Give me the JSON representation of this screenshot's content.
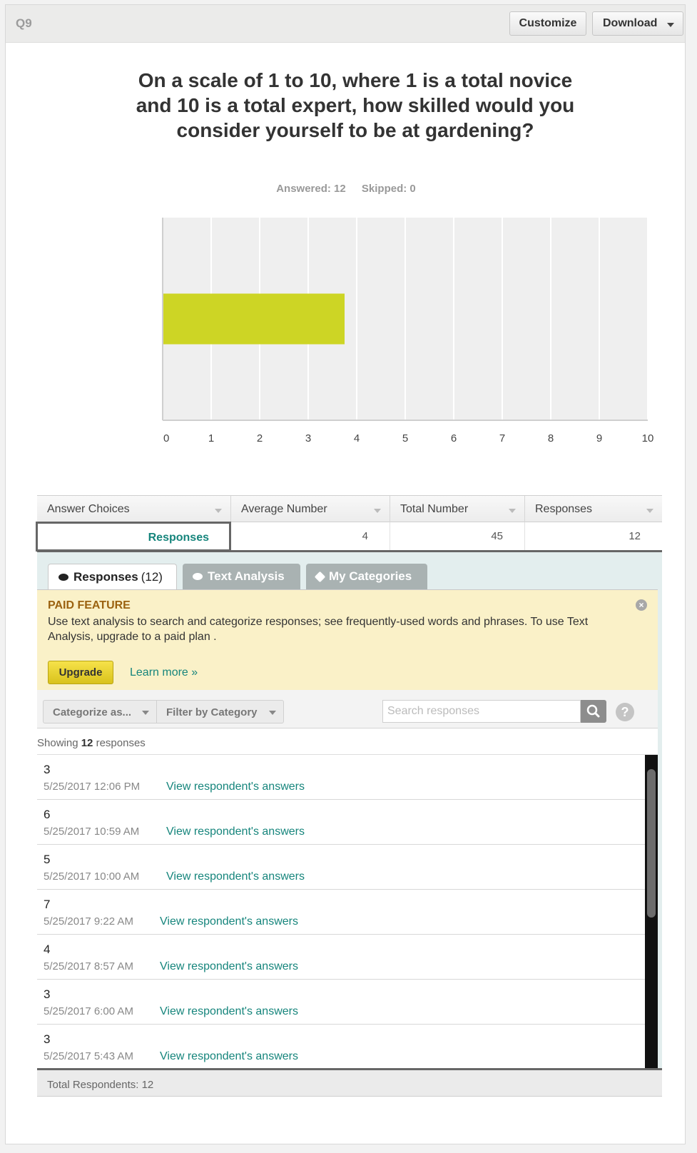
{
  "header": {
    "question_id": "Q9",
    "customize_label": "Customize",
    "download_label": "Download"
  },
  "question": {
    "title": "On a scale of 1 to 10, where 1 is a total novice and 10 is a total expert, how skilled would you consider yourself to be at gardening?",
    "answered": "Answered: 12",
    "skipped": "Skipped: 0"
  },
  "chart_data": {
    "type": "bar",
    "orientation": "horizontal",
    "categories": [
      "Responses"
    ],
    "values": [
      3.75
    ],
    "xlim": [
      0,
      10
    ],
    "x_ticks": [
      "0",
      "1",
      "2",
      "3",
      "4",
      "5",
      "6",
      "7",
      "8",
      "9",
      "10"
    ],
    "bar_color": "#cdd525",
    "grid": true,
    "title": "",
    "xlabel": "",
    "ylabel": ""
  },
  "table": {
    "headers": [
      "Answer Choices",
      "Average Number",
      "Total Number",
      "Responses"
    ],
    "row": {
      "choice": "Responses",
      "average": "4",
      "total": "45",
      "responses": "12"
    }
  },
  "tabs": {
    "responses_label": "Responses",
    "responses_count": "(12)",
    "text_analysis_label": "Text Analysis",
    "my_categories_label": "My Categories"
  },
  "paid_feature": {
    "title": "PAID FEATURE",
    "text": "Use text analysis to search and categorize responses; see frequently-used words and phrases. To use Text Analysis, upgrade to a paid plan .",
    "close_glyph": "×",
    "upgrade_label": "Upgrade",
    "learn_more_label": "Learn more »"
  },
  "filters": {
    "categorize_label": "Categorize as...",
    "filter_label": "Filter by Category",
    "search_placeholder": "Search responses",
    "help_glyph": "?"
  },
  "showing": {
    "prefix": "Showing",
    "count": "12",
    "suffix": "responses"
  },
  "responses": [
    {
      "value": "3",
      "date": "5/25/2017 12:06 PM",
      "link": "View respondent's answers"
    },
    {
      "value": "6",
      "date": "5/25/2017 10:59 AM",
      "link": "View respondent's answers"
    },
    {
      "value": "5",
      "date": "5/25/2017 10:00 AM",
      "link": "View respondent's answers"
    },
    {
      "value": "7",
      "date": "5/25/2017 9:22 AM",
      "link": "View respondent's answers"
    },
    {
      "value": "4",
      "date": "5/25/2017 8:57 AM",
      "link": "View respondent's answers"
    },
    {
      "value": "3",
      "date": "5/25/2017 6:00 AM",
      "link": "View respondent's answers"
    },
    {
      "value": "3",
      "date": "5/25/2017 5:43 AM",
      "link": "View respondent's answers"
    }
  ],
  "footer": {
    "total_respondents": "Total Respondents: 12"
  },
  "colors": {
    "accent_teal": "#16857c",
    "bar": "#cdd525",
    "paid_bg": "#faf1c8",
    "upgrade_yellow": "#f0d932"
  }
}
